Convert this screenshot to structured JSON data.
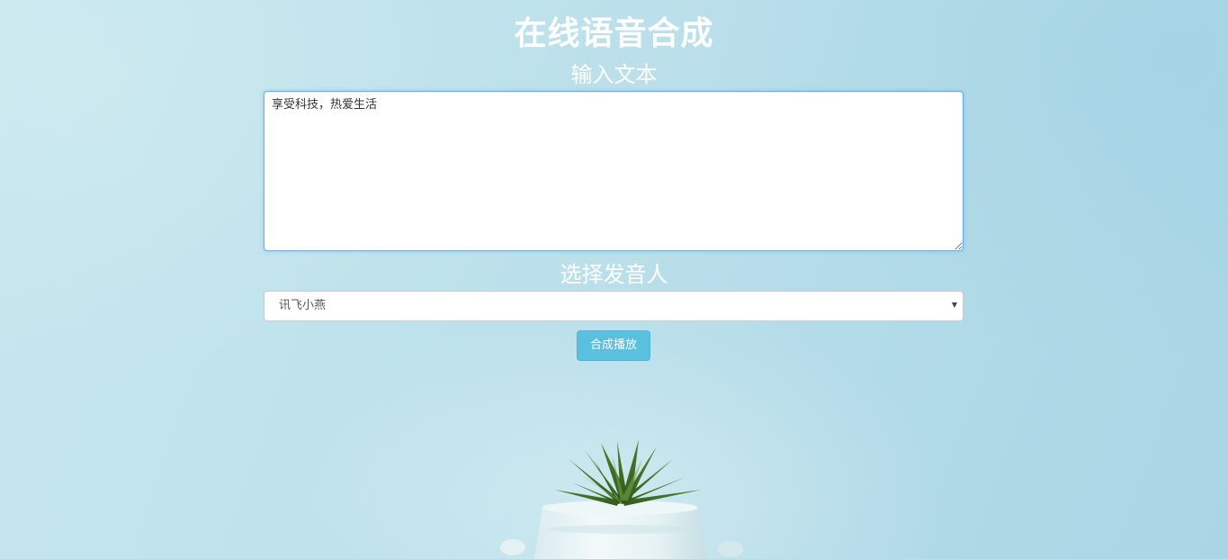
{
  "header": {
    "title": "在线语音合成"
  },
  "text_section": {
    "label": "输入文本",
    "input_value": "享受科技，热爱生活"
  },
  "voice_section": {
    "label": "选择发音人",
    "selected_voice": "讯飞小燕"
  },
  "actions": {
    "play_label": "合成播放"
  },
  "colors": {
    "background": "#bfe2ec",
    "button": "#5bc0de",
    "title_text": "#ffffff"
  }
}
